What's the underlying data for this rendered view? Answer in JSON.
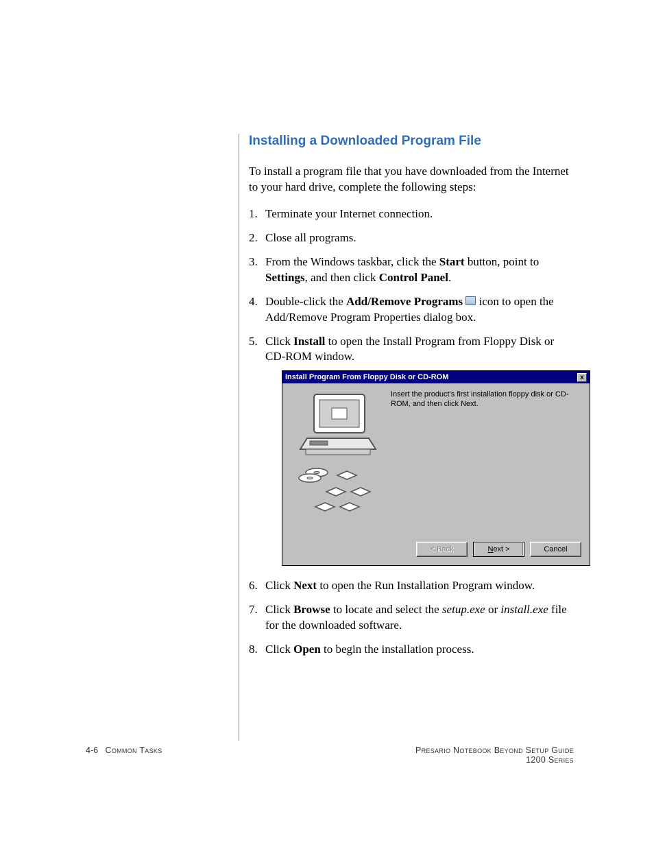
{
  "heading": "Installing a Downloaded Program File",
  "intro": "To install a program file that you have downloaded from the Internet to your hard drive, complete the following steps:",
  "steps": {
    "s1": "Terminate your Internet connection.",
    "s2": "Close all programs.",
    "s3a": "From the Windows taskbar, click the ",
    "s3b_bold": "Start",
    "s3c": " button, point to ",
    "s3d_bold": "Settings",
    "s3e": ", and then click ",
    "s3f_bold": "Control Panel",
    "s3g": ".",
    "s4a": "Double-click the ",
    "s4b_bold": "Add/Remove Programs",
    "s4c": "  icon to open the Add/Remove Program Properties dialog box.",
    "s5a": "Click ",
    "s5b_bold": "Install",
    "s5c": " to open the Install Program from Floppy Disk or CD-ROM window.",
    "s6a": "Click ",
    "s6b_bold": "Next",
    "s6c": " to open the Run Installation Program window.",
    "s7a": "Click ",
    "s7b_bold": "Browse",
    "s7c": " to locate and select the ",
    "s7d_ital": "setup.exe",
    "s7e": " or ",
    "s7f_ital": "install.exe",
    "s7g": " file for the downloaded software.",
    "s8a": "Click ",
    "s8b_bold": "Open",
    "s8c": " to begin the installation process."
  },
  "dialog": {
    "title": "Install Program From Floppy Disk or CD-ROM",
    "close": "x",
    "body_text": "Insert the product's first installation floppy disk or CD-ROM, and then click Next.",
    "btn_back": "< Back",
    "btn_next_prefix": "N",
    "btn_next_suffix": "ext >",
    "btn_cancel": "Cancel"
  },
  "footer": {
    "page_number": "4-6",
    "section": "Common Tasks",
    "guide_line1": "Presario Notebook Beyond Setup Guide",
    "guide_line2": "1200 Series"
  }
}
